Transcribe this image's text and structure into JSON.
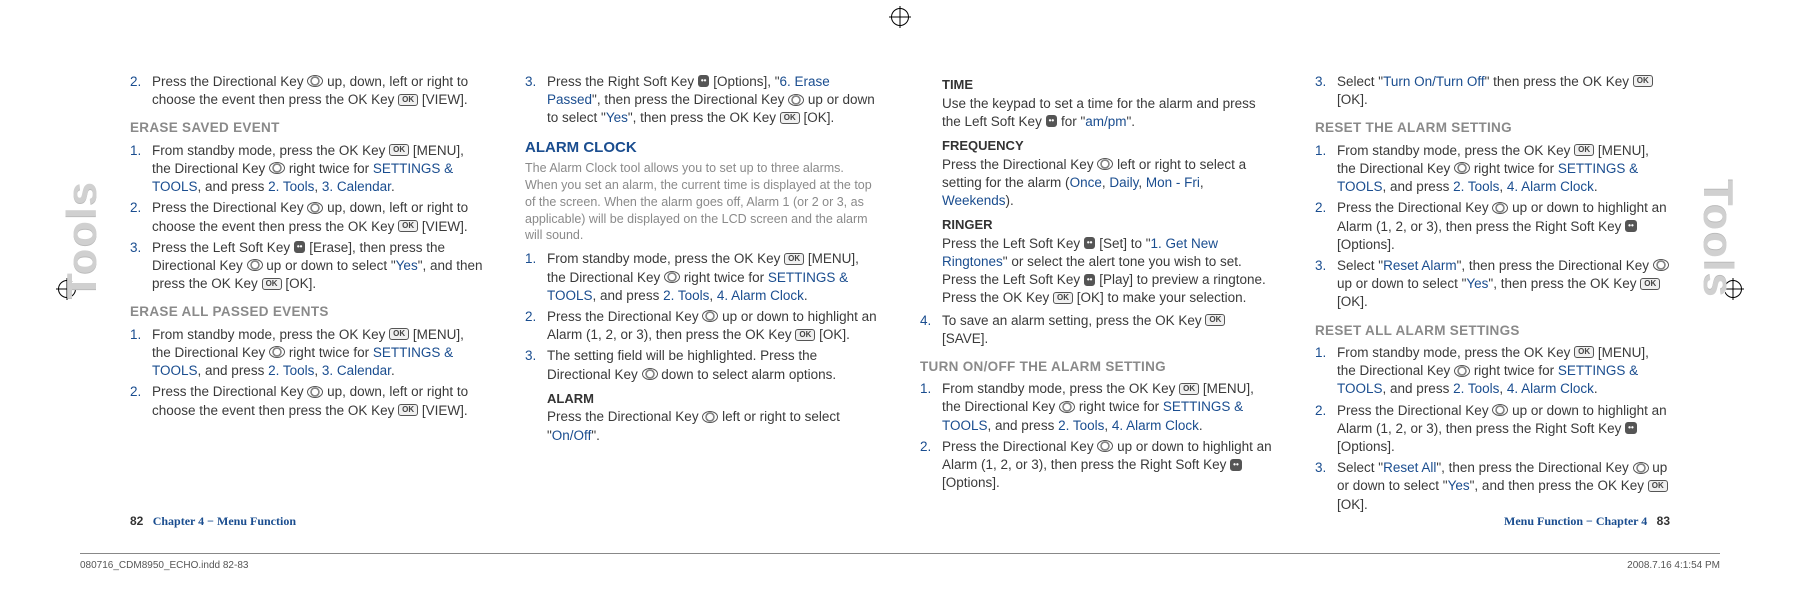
{
  "sideTab": "Tools",
  "icons": {
    "ok": "OK",
    "nav": "",
    "soft": "•••"
  },
  "col1": {
    "s2_num": "2.",
    "s2": "Press the Directional Key {nav} up, down, left or right to choose the event then press the OK Key {ok} [VIEW].",
    "h1": "ERASE SAVED EVENT",
    "es1_num": "1.",
    "es1": "From standby mode, press the OK Key {ok} [MENU], the Directional Key {nav} right twice for {blue:SETTINGS & TOOLS}, and press {blue:2. Tools}, {blue:3. Calendar}.",
    "es2_num": "2.",
    "es2": "Press the Directional Key {nav} up, down, left or right to choose the event then press the OK Key {ok} [VIEW].",
    "es3_num": "3.",
    "es3": "Press the Left Soft Key {soft} [Erase], then press the Directional Key {nav} up or down to select \"{blue:Yes}\", and then press the OK Key {ok} [OK].",
    "h2": "ERASE ALL PASSED EVENTS",
    "ep1_num": "1.",
    "ep1": "From standby mode, press the OK Key {ok} [MENU], the Directional Key {nav} right twice for {blue:SETTINGS & TOOLS}, and press {blue:2. Tools}, {blue:3. Calendar}.",
    "ep2_num": "2.",
    "ep2": "Press the Directional Key {nav} up, down, left or right to choose the event then press the OK Key {ok} [VIEW]."
  },
  "col2": {
    "s3_num": "3.",
    "s3": "Press the Right Soft Key {soft} [Options], \"{blue:6. Erase Passed}\", then press the Directional Key {nav} up or down to select \"{blue:Yes}\", then press the OK Key {ok} [OK].",
    "title": "ALARM CLOCK",
    "intro": "The Alarm Clock tool allows you to set up to three alarms. When you set an alarm, the current time is displayed at the top of the screen. When the alarm goes off, Alarm 1 (or 2 or 3, as applicable) will be displayed on the LCD screen and the alarm will sound.",
    "a1_num": "1.",
    "a1": "From standby mode, press the OK Key {ok} [MENU], the Directional Key {nav} right twice for {blue:SETTINGS & TOOLS}, and press {blue:2. Tools}, {blue:4. Alarm Clock}.",
    "a2_num": "2.",
    "a2": "Press the Directional Key {nav} up or down to highlight an Alarm (1, 2, or 3), then press the OK Key {ok} [OK].",
    "a3_num": "3.",
    "a3": "The setting field will be highlighted. Press the Directional Key {nav} down to select alarm options.",
    "alarm_lbl": "ALARM",
    "alarm_txt": "Press the Directional Key {nav} left or right to select \"{blue:On/Off}\"."
  },
  "col3": {
    "time_lbl": "TIME",
    "time_txt": "Use the keypad to set a time for the alarm and press the Left Soft Key {soft} for \"{blue:am/pm}\".",
    "freq_lbl": "FREQUENCY",
    "freq_txt": "Press the Directional Key {nav} left or right to select a setting for the alarm ({blue:Once}, {blue:Daily}, {blue:Mon - Fri}, {blue:Weekends}).",
    "ring_lbl": "RINGER",
    "ring_txt": "Press the Left Soft Key {soft} [Set] to \"{blue:1. Get New Ringtones}\" or select the alert tone you wish to set. Press the Left Soft Key {soft} [Play] to preview a ringtone.  Press the OK Key {ok} [OK] to make your selection.",
    "a4_num": "4.",
    "a4": "To save an alarm setting, press the OK Key {ok} [SAVE].",
    "h1": "TURN ON/OFF THE ALARM SETTING",
    "t1_num": "1.",
    "t1": "From standby mode, press the OK Key {ok} [MENU], the Directional Key {nav} right twice for {blue:SETTINGS & TOOLS}, and press {blue:2. Tools}, {blue:4. Alarm Clock}.",
    "t2_num": "2.",
    "t2": "Press the Directional Key {nav} up or down to highlight an Alarm (1, 2, or 3), then press the Right Soft Key {soft} [Options]."
  },
  "col4": {
    "t3_num": "3.",
    "t3": "Select \"{blue:Turn On/Turn Off}\" then press the OK Key {ok} [OK].",
    "h1": "RESET THE ALARM SETTING",
    "r1_num": "1.",
    "r1": "From standby mode, press the OK Key {ok} [MENU], the Directional Key {nav} right twice for {blue:SETTINGS & TOOLS}, and press {blue:2. Tools}, {blue:4. Alarm Clock}.",
    "r2_num": "2.",
    "r2": "Press the Directional Key {nav} up or down to highlight an Alarm (1, 2, or 3), then press the Right Soft Key {soft} [Options].",
    "r3_num": "3.",
    "r3": "Select \"{blue:Reset Alarm}\", then press the Directional Key {nav} up or down to select \"{blue:Yes}\", then press the OK Key {ok} [OK].",
    "h2": "RESET ALL ALARM SETTINGS",
    "ra1_num": "1.",
    "ra1": "From standby mode, press the OK Key {ok} [MENU], the Directional Key {nav} right twice for {blue:SETTINGS & TOOLS}, and press {blue:2. Tools}, {blue:4. Alarm Clock}.",
    "ra2_num": "2.",
    "ra2": "Press the Directional Key {nav} up or down to highlight an Alarm (1, 2, or 3), then press the Right Soft Key {soft} [Options].",
    "ra3_num": "3.",
    "ra3": "Select \"{blue:Reset All}\", then press the Directional Key {nav} up or down to select \"{blue:Yes}\", and then press the OK Key {ok} [OK]."
  },
  "footer": {
    "leftPage": "82",
    "leftChapter": "Chapter 4 − Menu Function",
    "rightChapter": "Menu Function − Chapter 4",
    "rightPage": "83"
  },
  "printLine": {
    "file": "080716_CDM8950_ECHO.indd   82-83",
    "date": "2008.7.16   4:1:54 PM"
  }
}
